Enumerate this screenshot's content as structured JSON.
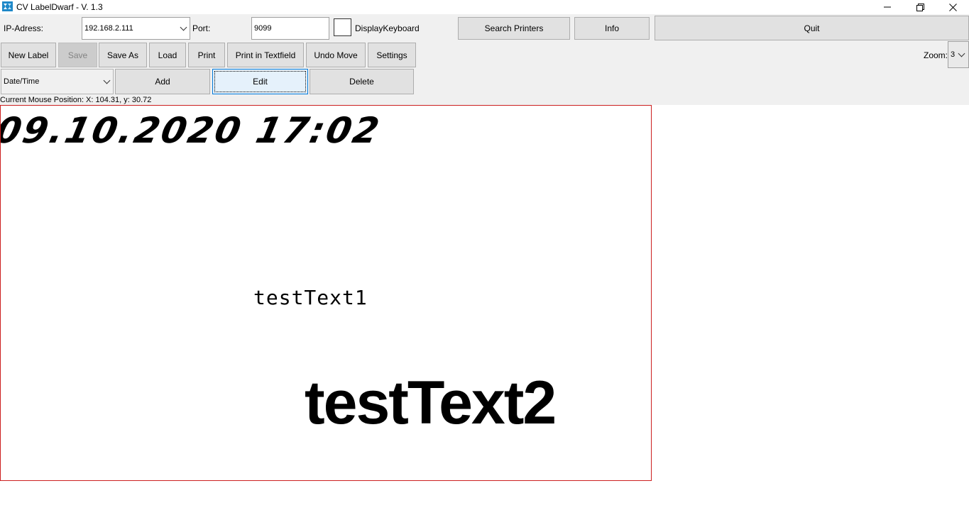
{
  "window": {
    "title": "CV LabelDwarf - V. 1.3",
    "icon": "app-icon",
    "controls": {
      "minimize": "–",
      "maximize": "❐",
      "close": "✕"
    }
  },
  "connection": {
    "ip_label": "IP-Adress:",
    "ip_value": "192.168.2.111",
    "port_label": "Port:",
    "port_value": "9099",
    "display_keyboard_label": "DisplayKeyboard",
    "display_keyboard_checked": false,
    "search_printers": "Search Printers",
    "info": "Info",
    "quit": "Quit"
  },
  "toolbar": {
    "new_label": "New Label",
    "save": "Save",
    "save_as": "Save As",
    "load": "Load",
    "print": "Print",
    "print_in_textfield": "Print in Textfield",
    "undo_move": "Undo Move",
    "settings": "Settings",
    "zoom_label": "Zoom:",
    "zoom_value": "3"
  },
  "elements": {
    "type_value": "Date/Time",
    "add": "Add",
    "edit": "Edit",
    "delete": "Delete"
  },
  "status": {
    "mouse_position": "Current Mouse Position: X: 104.31, y: 30.72"
  },
  "label": {
    "border_color": "#cc1f1f",
    "items": [
      {
        "text": "09.10.2020 17:02"
      },
      {
        "text": "testText1"
      },
      {
        "text": "testText2"
      }
    ]
  },
  "colors": {
    "toolbar_bg": "#f0f0f0",
    "button_bg": "#e1e1e1",
    "focus_blue": "#0078d7"
  }
}
